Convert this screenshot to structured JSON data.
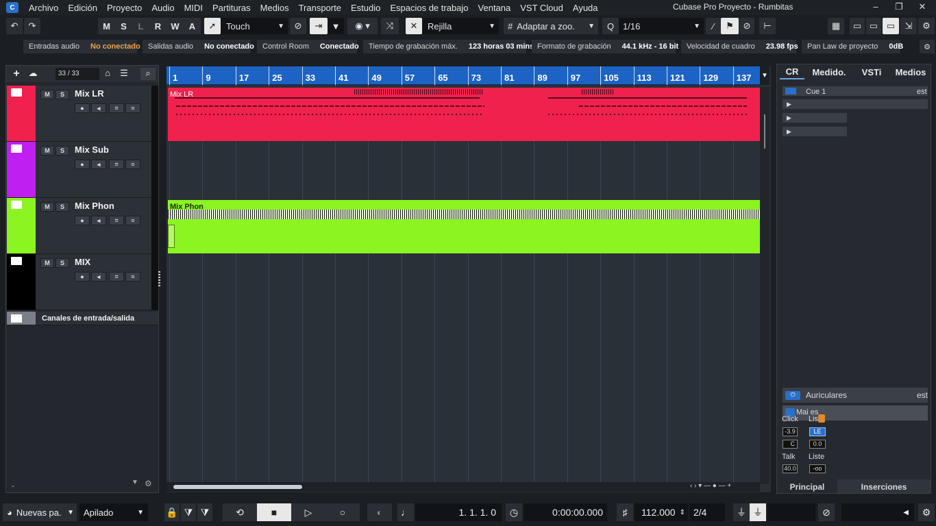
{
  "menu": {
    "items": [
      "Archivo",
      "Edición",
      "Proyecto",
      "Audio",
      "MIDI",
      "Partituras",
      "Medios",
      "Transporte",
      "Estudio",
      "Espacios de trabajo",
      "Ventana",
      "VST Cloud",
      "Ayuda"
    ],
    "window_title": "Cubase Pro Proyecto - Rumbitas"
  },
  "toolbar": {
    "msl": [
      "M",
      "S",
      "L",
      "R",
      "W",
      "A"
    ],
    "automation_mode": "Touch",
    "snap_type": "Rejilla",
    "grid_mode": "Adaptar a zoo.",
    "quantize": "1/16"
  },
  "status": [
    {
      "key": "Entradas audio",
      "value": "No conectado",
      "warn": true
    },
    {
      "key": "Salidas audio",
      "value": "No conectado",
      "warn": false
    },
    {
      "key": "Control Room",
      "value": "Conectado",
      "warn": false
    },
    {
      "key": "Tiempo de grabación máx.",
      "value": "123 horas 03 mins",
      "warn": false
    },
    {
      "key": "Formato de grabación",
      "value": "44.1 kHz - 16 bit",
      "warn": false
    },
    {
      "key": "Velocidad de cuadro",
      "value": "23.98 fps",
      "warn": false
    },
    {
      "key": "Pan Law de proyecto",
      "value": "0dB",
      "warn": false
    }
  ],
  "track_list": {
    "count": "33 / 33",
    "tracks": [
      {
        "name": "Mix LR",
        "color": "#f0214c"
      },
      {
        "name": "Mix Sub",
        "color": "#c01ff2"
      },
      {
        "name": "Mix Phon",
        "color": "#8bf421"
      },
      {
        "name": "MIX",
        "color": "#000000"
      }
    ],
    "io_folder": "Canales de entrada/salida",
    "footer": "-"
  },
  "ruler": {
    "bars": [
      "1",
      "9",
      "17",
      "25",
      "33",
      "41",
      "49",
      "57",
      "65",
      "73",
      "81",
      "89",
      "97",
      "105",
      "113",
      "121",
      "129",
      "137"
    ]
  },
  "events": {
    "mix_lr": "Mix LR",
    "mix_phon": "Mix Phon"
  },
  "right_panel": {
    "tabs": [
      "CR",
      "Medido.",
      "VSTi",
      "Medios"
    ],
    "cue": "Cue 1",
    "cue_suffix": "est",
    "phones": "Auriculares",
    "phones_suffix": "est",
    "main": "Mai      es",
    "click_label": "Click",
    "click_value": "-3.9",
    "click_c": "C",
    "liste_label": "Lis",
    "liste_btn": "LE",
    "liste_value": "0.0",
    "talk_label": "Talk",
    "talk_value": "40.0",
    "liste2_label": "Liste",
    "liste2_value": "-oo",
    "bottom_tabs": [
      "Principal",
      "Inserciones"
    ]
  },
  "transport": {
    "preset": "Nuevas pa.",
    "mode": "Apilado",
    "position": "1. 1. 1.   0",
    "time": "0:00:00.000",
    "tempo": "112.000",
    "signature": "2/4"
  }
}
